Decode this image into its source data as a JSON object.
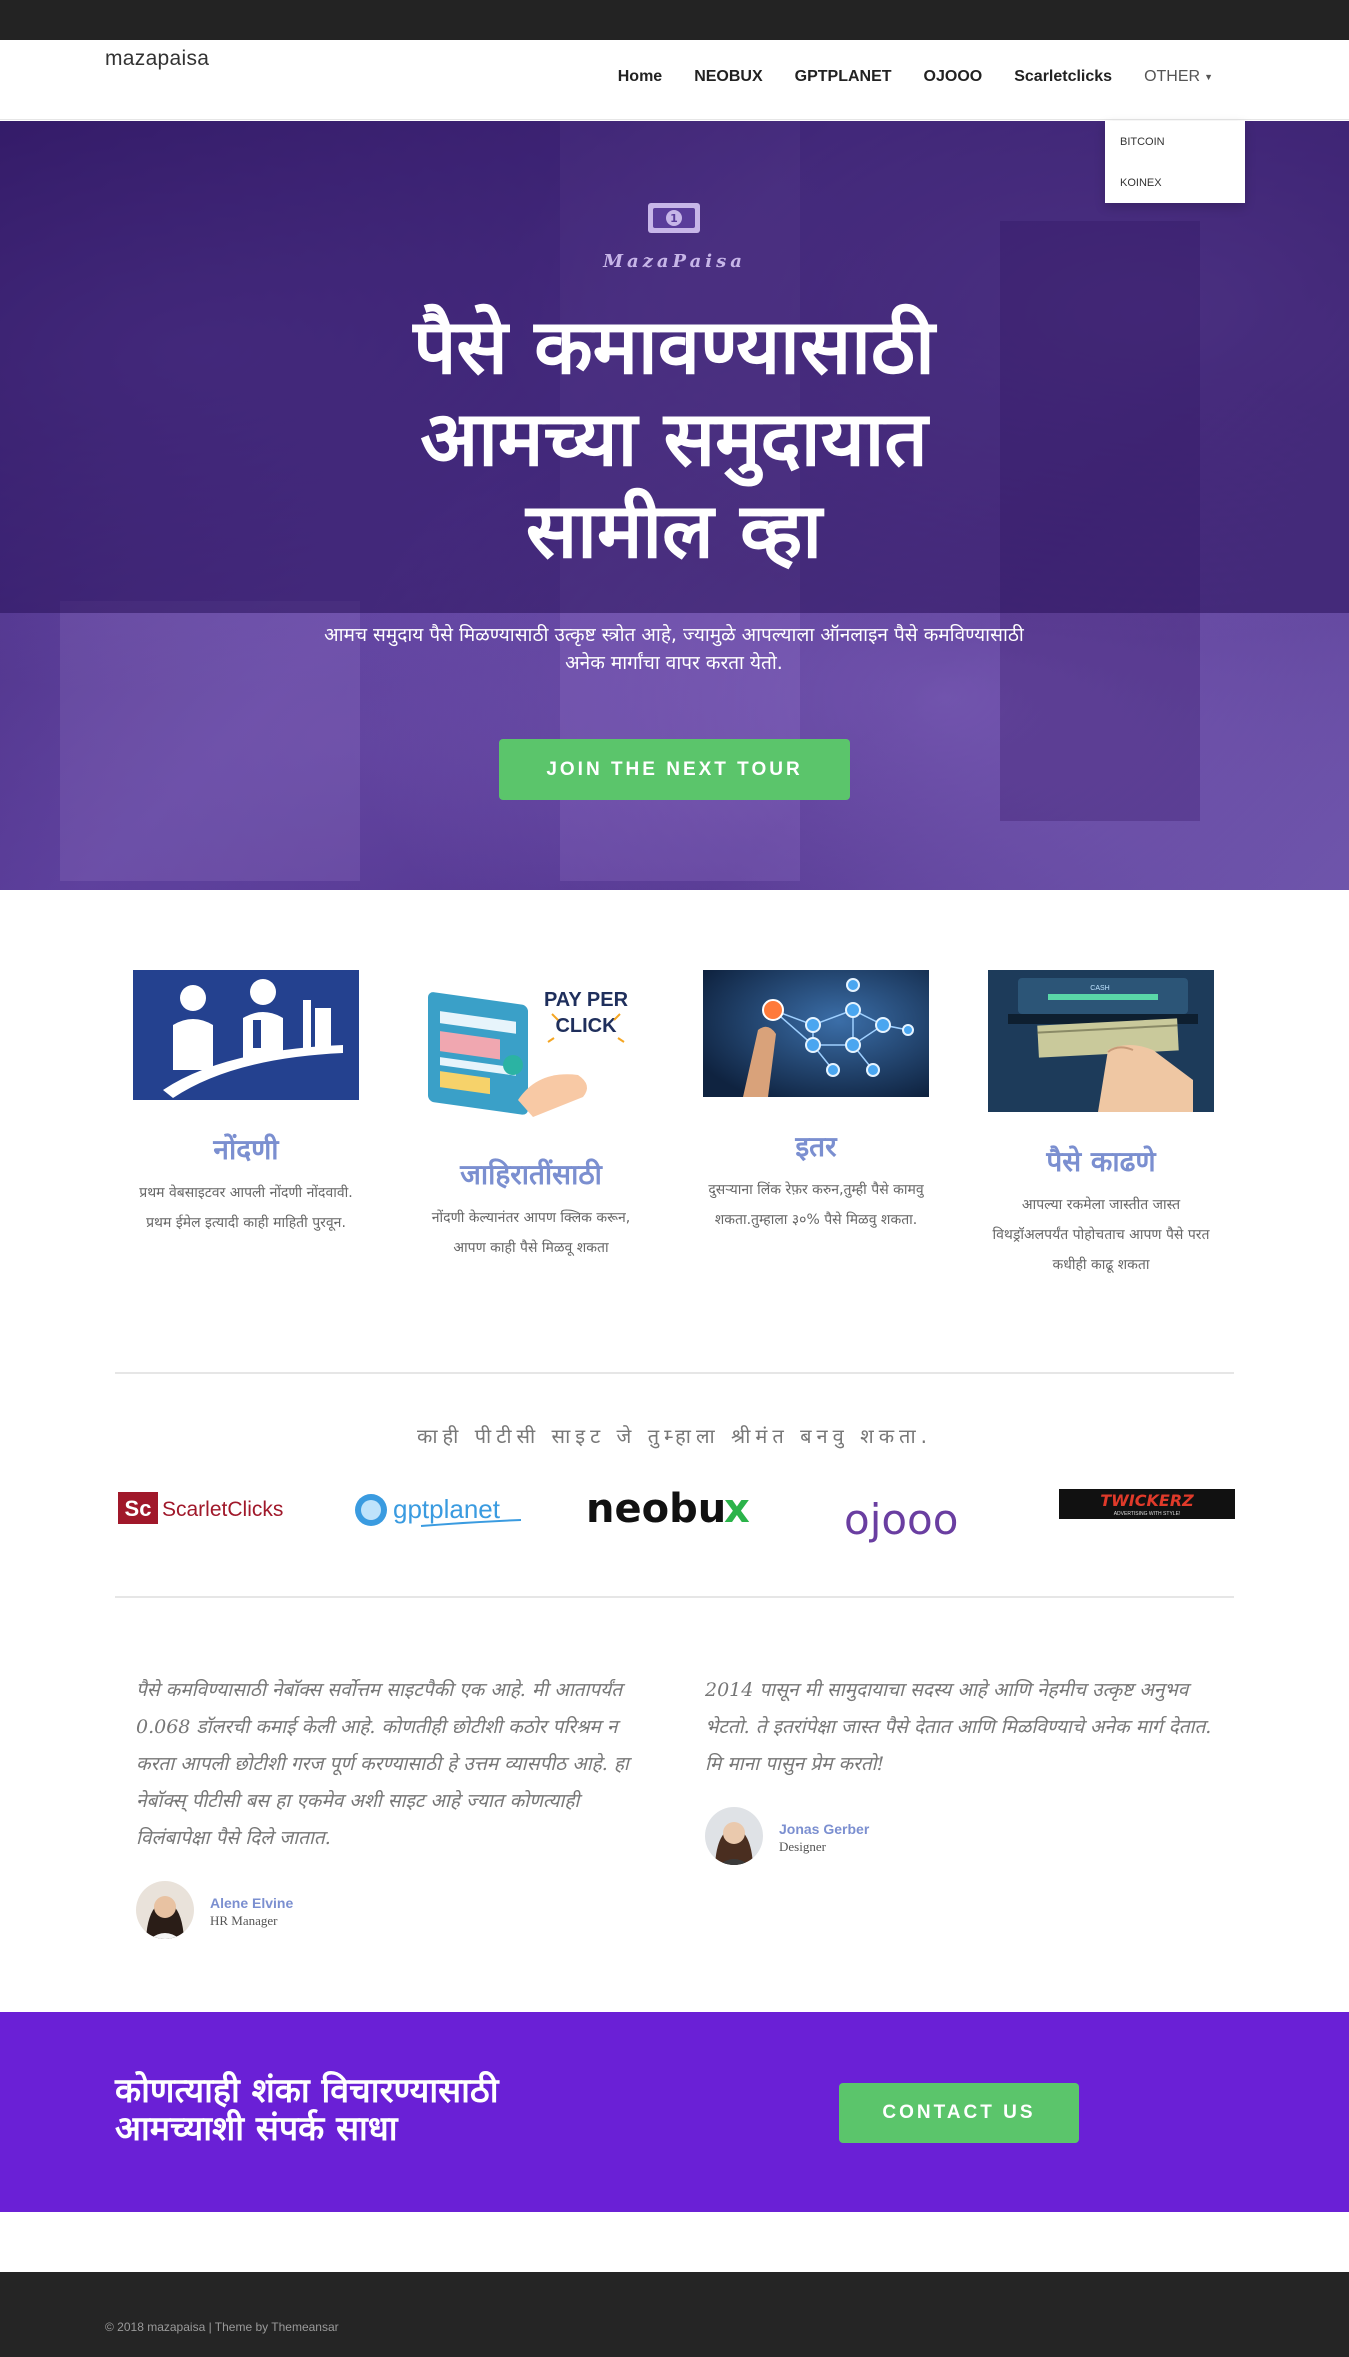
{
  "header": {
    "brand": "mazapaisa",
    "nav": [
      "Home",
      "NEOBUX",
      "GPTPLANET",
      "OJOOO",
      "Scarletclicks"
    ],
    "other_label": "OTHER",
    "dropdown": [
      "BITCOIN",
      "KOINEX"
    ]
  },
  "hero": {
    "logo_text": "MazaPaisa",
    "title_lines": [
      "पैसे कमावण्यासाठी",
      "आमच्या समुदायात",
      "सामील व्हा"
    ],
    "subtitle_lines": [
      "आमच समुदाय पैसे मिळण्यासाठी उत्कृष्ट स्त्रोत आहे, ज्यामुळे आपल्याला ऑनलाइन पैसे कमविण्यासाठी",
      "अनेक मार्गांचा वापर करता येतो."
    ],
    "button": "JOIN THE NEXT TOUR"
  },
  "features": [
    {
      "title": "नोंदणी",
      "text": "प्रथम वेबसाइटवर आपली नोंदणी नोंदवावी. प्रथम ईमेल इत्यादी काही माहिती पुरवून.",
      "image_label": "registration-illustration"
    },
    {
      "title": "जाहिरातींसाठी",
      "text": "नोंदणी केल्यानंतर आपण क्लिक करून, आपण काही पैसे मिळवू शकता",
      "image_label": "pay-per-click-illustration",
      "image_text": [
        "PAY PER",
        "CLICK"
      ]
    },
    {
      "title": "इतर",
      "text": "दुसऱ्याना लिंक रेफ़र करुन,तुम्ही पैसे कामवु शकता.तुम्हाला ३०% पैसे मिळवु शकता.",
      "image_label": "network-illustration"
    },
    {
      "title": "पैसे काढणे",
      "text": "आपल्या रकमेला जास्तीत जास्त विथड्रॉअलपर्यंत पोहोचताच आपण पैसे परत कधीही काढू शकता",
      "image_label": "atm-withdrawal-photo",
      "image_text": [
        "CASH"
      ]
    }
  ],
  "partners": {
    "title": "काही पीटीसी साइट जे तुम्हाला श्रीमंत बनवु शकता.",
    "logos": [
      {
        "name": "scarletclicks",
        "mark": "Sc",
        "text": "ScarletClicks",
        "color": "#a0182a"
      },
      {
        "name": "gptplanet",
        "text": "gptplanet",
        "color": "#3a9be0"
      },
      {
        "name": "neobux",
        "text": "neobu",
        "suffix": "x",
        "color": "#111111",
        "accent": "#2bb34a"
      },
      {
        "name": "ojooo",
        "text": "ojooo",
        "color": "#6a3ea1"
      },
      {
        "name": "twickerz",
        "text": "TWICKERZ",
        "sub": "ADVERTISING WITH STYLE!",
        "color": "#e03a2a"
      }
    ]
  },
  "testimonials": [
    {
      "quote": "पैसे कमविण्यासाठी नेबॉक्स सर्वोत्तम साइटपैकी एक आहे. मी आतापर्यंत 0.068 डॉलरची कमाई केली आहे. कोणतीही छोटीशी कठोर परिश्रम न करता आपली छोटीशी गरज पूर्ण करण्यासाठी हे उत्तम व्यासपीठ आहे. हा नेबॉक्स् पीटीसी बस हा एकमेव अशी साइट आहे ज्यात कोणत्याही विलंबापेक्षा पैसे दिले जातात.",
      "name": "Alene Elvine",
      "role": "HR Manager"
    },
    {
      "quote": "2014 पासून मी सामुदायाचा सदस्य आहे आणि नेहमीच उत्कृष्ट अनुभव भेटतो. ते इतरांपेक्षा जास्त पैसे देतात आणि मिळविण्याचे अनेक मार्ग देतात. मि माना पासुन प्रेम करतो!",
      "name": "Jonas Gerber",
      "role": "Designer"
    }
  ],
  "cta": {
    "title_lines": [
      "कोणत्याही शंका विचारण्यासाठी",
      "आमच्याशी संपर्क साधा"
    ],
    "button": "CONTACT US"
  },
  "footer": {
    "text": "© 2018 mazapaisa | Theme by Themeansar"
  },
  "colors": {
    "accent_green": "#5bc56b",
    "hero_purple": "#4a2d86",
    "cta_purple": "#6a20d6",
    "feature_title": "#7b8fd0"
  }
}
